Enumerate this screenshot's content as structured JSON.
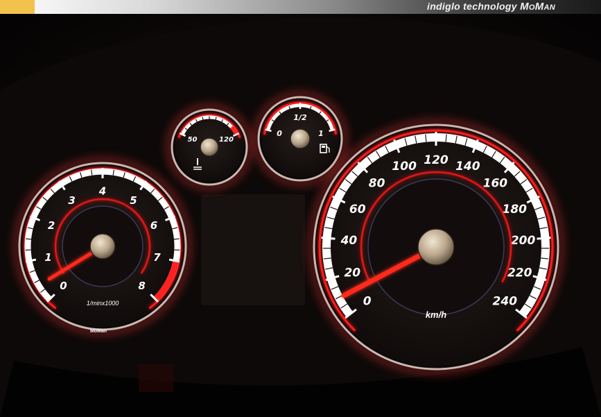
{
  "banner": {
    "text": "indiglo technology",
    "brand": "MoMan"
  },
  "tachometer": {
    "ticks": [
      "0",
      "1",
      "2",
      "3",
      "4",
      "5",
      "6",
      "7",
      "8"
    ],
    "unit_label": "1/minx1000",
    "maker_label": "MoMan",
    "reading_fraction": 0.05
  },
  "temperature_gauge": {
    "ticks": [
      "50",
      "120"
    ],
    "icon": "coolant-temperature-icon",
    "reading_fraction": 0.5
  },
  "fuel_gauge": {
    "ticks": [
      "0",
      "1/2",
      "1"
    ],
    "icon": "fuel-pump-icon",
    "reading_fraction": 0.02
  },
  "speedometer": {
    "ticks": [
      "0",
      "20",
      "40",
      "60",
      "80",
      "100",
      "120",
      "140",
      "160",
      "180",
      "200",
      "220",
      "240"
    ],
    "unit_label": "km/h",
    "reading_fraction": 0.04
  },
  "colors": {
    "glow_red": "#ff1a1a",
    "dial_white": "#ffffff",
    "face": "#141010",
    "banner_gold": "#f3c24a"
  }
}
